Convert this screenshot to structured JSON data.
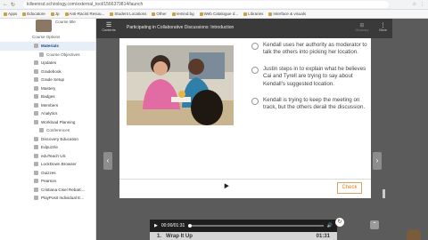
{
  "browser": {
    "url": "killeenisd.schoology.com/external_tool/1566379814/launch",
    "bookmarks": [
      "Apps",
      "Educatore",
      "Jp",
      "Anti-Racist Resou...",
      "Student Locations",
      "Other",
      "remind.bg",
      "Web Catalogue d...",
      "Libraries",
      "Interface & visuals"
    ]
  },
  "sidebar": {
    "course_title": "Course title",
    "course_options": "Course Options",
    "items": [
      {
        "label": "Materials",
        "active": true
      },
      {
        "label": "Course Objectives",
        "sub": true
      },
      {
        "label": "Updates"
      },
      {
        "label": "Gradebook"
      },
      {
        "label": "Grade Setup"
      },
      {
        "label": "Mastery"
      },
      {
        "label": "Badges"
      },
      {
        "label": "Members"
      },
      {
        "label": "Analytics"
      },
      {
        "label": "Workload Planning"
      },
      {
        "label": "Conferences",
        "sub": true
      },
      {
        "label": "Discovery Education"
      },
      {
        "label": "Edpuzzle"
      },
      {
        "label": "eduTeach US"
      },
      {
        "label": "LockDown Browser"
      },
      {
        "label": "Ouizzes"
      },
      {
        "label": "Pearson"
      },
      {
        "label": "Cristiana Cisel Rebatc..."
      },
      {
        "label": "PlayPosit Individual E..."
      }
    ]
  },
  "player": {
    "menu_label": "Contents",
    "title": "Participating in Collaborative Discussions: Introduction",
    "glossary_label": "Glossary",
    "more_label": "More",
    "options": [
      "Kendall uses her authority as moderator to talk the others into picking her location.",
      "Justin steps in to explain what he believes Cai and Tyrell are trying to say about Kendall's suggested location.",
      "Kendall is trying to keep the meeting on track, but the others derail the discussion."
    ],
    "check_label": "Check"
  },
  "audio": {
    "time": "00:00/01:31",
    "track_number": "1.",
    "track_title": "Wrap It Up",
    "track_duration": "01:31"
  }
}
